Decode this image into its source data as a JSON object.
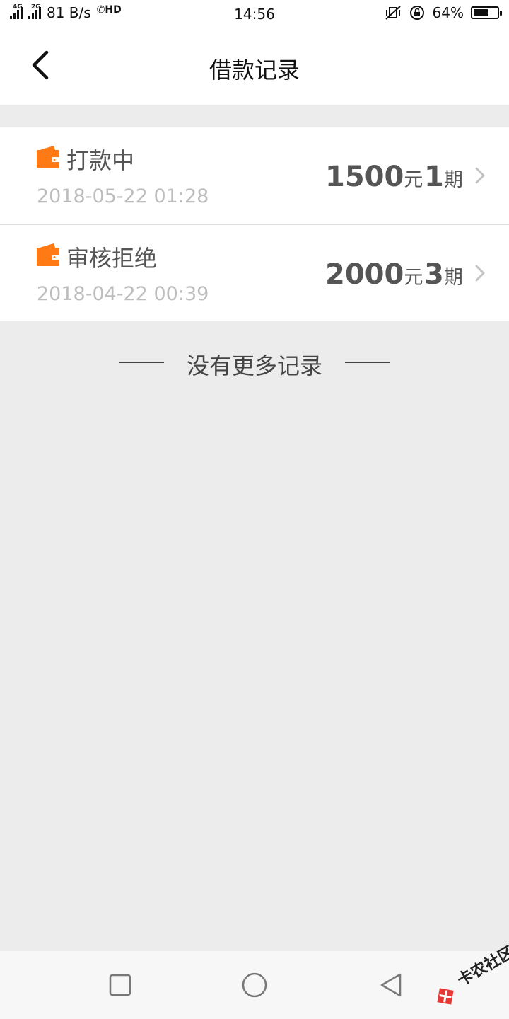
{
  "status_bar": {
    "network_1": "4G",
    "network_2": "2G",
    "speed": "81 B/s",
    "call_hd": "HD",
    "time": "14:56",
    "battery": "64%",
    "battery_level": 0.64
  },
  "header": {
    "title": "借款记录",
    "back_icon": "chevron-left-icon"
  },
  "records": [
    {
      "status": "打款中",
      "date": "2018-05-22 01:28",
      "amount": "1500",
      "amount_unit": "元",
      "period": "1",
      "period_unit": "期"
    },
    {
      "status": "审核拒绝",
      "date": "2018-04-22 00:39",
      "amount": "2000",
      "amount_unit": "元",
      "period": "3",
      "period_unit": "期"
    }
  ],
  "footer_note": "没有更多记录",
  "watermark": "卡农社区",
  "colors": {
    "accent": "#ff7a14",
    "background": "#ececec",
    "muted_text": "#bdbdbd"
  }
}
